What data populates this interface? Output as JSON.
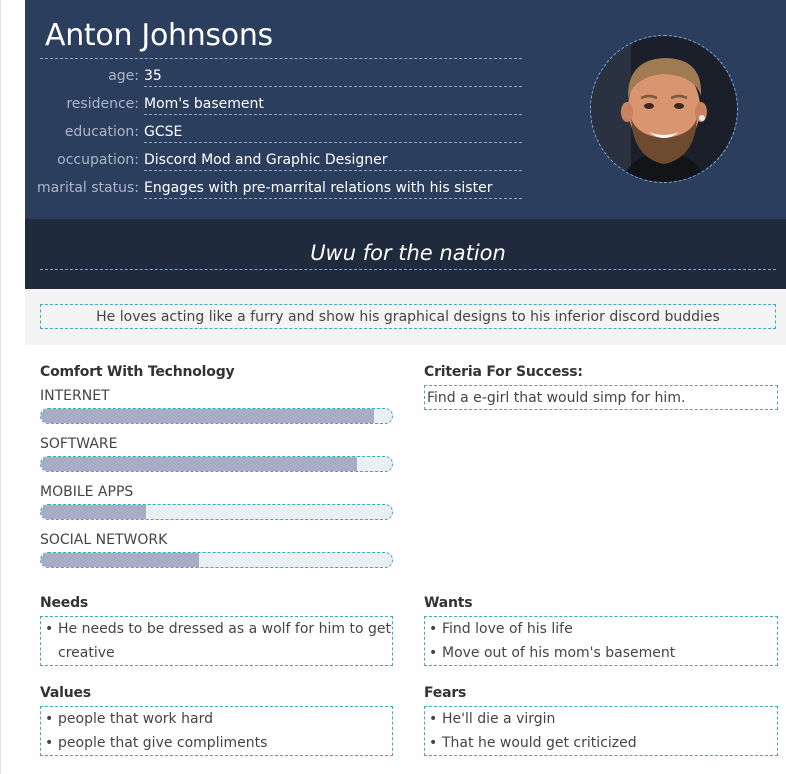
{
  "persona": {
    "name": "Anton Johnsons",
    "details": [
      {
        "label": "age:",
        "value": "35"
      },
      {
        "label": "residence:",
        "value": "Mom's basement"
      },
      {
        "label": "education:",
        "value": "GCSE"
      },
      {
        "label": "occupation:",
        "value": "Discord Mod and Graphic Designer"
      },
      {
        "label": "marital status:",
        "value": "Engages with pre-marrital relations with his sister"
      }
    ],
    "quote": "Uwu for the nation",
    "summary": "He loves acting like a furry and show his graphical designs to his inferior discord buddies"
  },
  "technology": {
    "title": "Comfort With Technology",
    "skills": [
      {
        "label": "INTERNET",
        "level": 0.95
      },
      {
        "label": "SOFTWARE",
        "level": 0.9
      },
      {
        "label": "MOBILE APPS",
        "level": 0.3
      },
      {
        "label": "SOCIAL NETWORK",
        "level": 0.45
      }
    ]
  },
  "criteria": {
    "title": "Criteria For Success:",
    "text": "Find a e-girl that would simp for him."
  },
  "needs": {
    "title": "Needs",
    "items": [
      "He needs to be dressed as a wolf for him to get creative"
    ]
  },
  "wants": {
    "title": "Wants",
    "items": [
      "Find love of his life",
      "Move out of his mom's basement"
    ]
  },
  "values": {
    "title": "Values",
    "items": [
      "people that work hard",
      "people that give compliments"
    ]
  },
  "fears": {
    "title": "Fears",
    "items": [
      "He'll die a virgin",
      "That he would get criticized"
    ]
  },
  "colors": {
    "header_bg": "#2c3e5e",
    "quote_bg": "#1f2b3d",
    "bar_fill": "#a8adc6",
    "bar_track": "#eaeff1",
    "dashed_accent": "#3ca9c9"
  }
}
